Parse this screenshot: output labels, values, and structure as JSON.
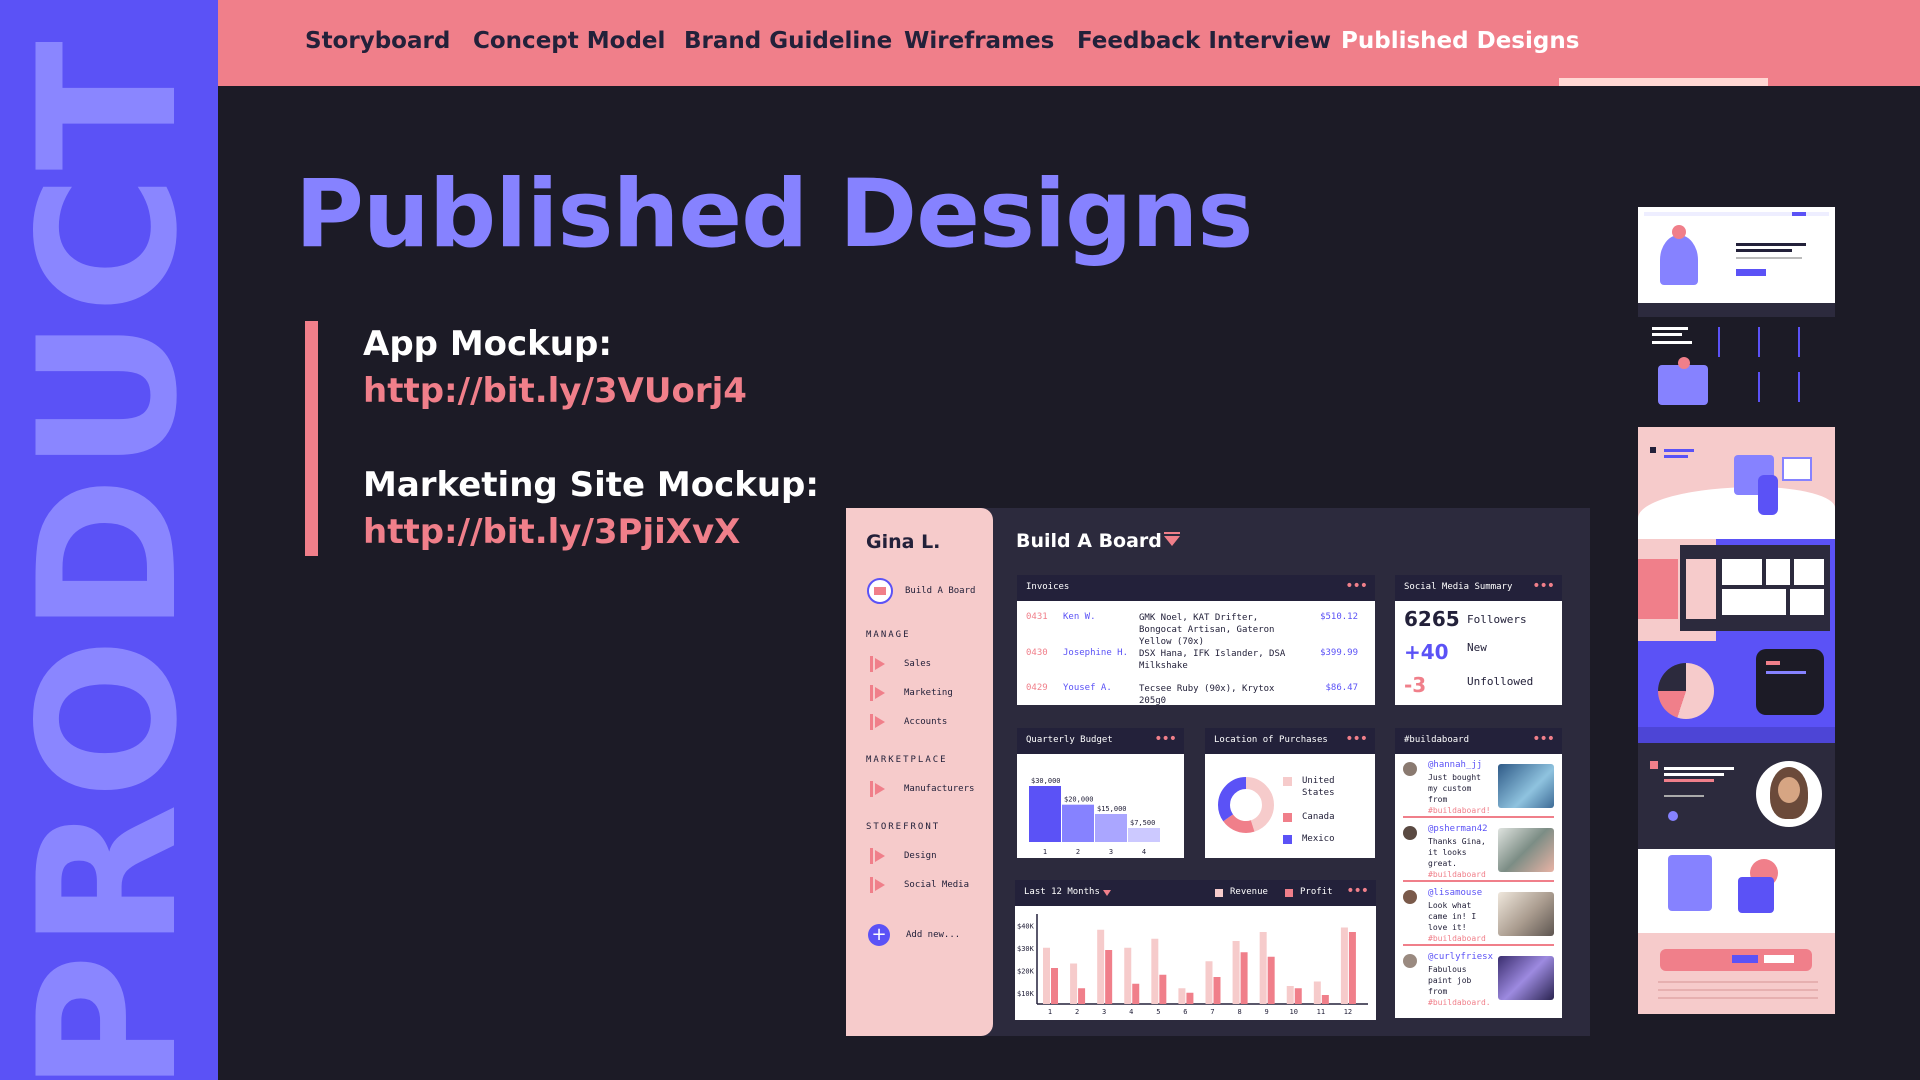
{
  "rail": {
    "word": "PRODUCT"
  },
  "nav": {
    "tabs": [
      "Storyboard",
      "Concept Model",
      "Brand Guideline",
      "Wireframes",
      "Feedback Interview",
      "Published Designs"
    ],
    "active": "Published Designs"
  },
  "page": {
    "title": "Published Designs",
    "links": [
      {
        "label": "App Mockup:",
        "url": "http://bit.ly/3VUorj4"
      },
      {
        "label": "Marketing Site Mockup:",
        "url": "http://bit.ly/3PjiXvX"
      }
    ]
  },
  "colors": {
    "purple": "#5b52f6",
    "lavender": "#8682ff",
    "pink": "#f07f8a",
    "blush": "#f6cbcb",
    "dark": "#1c1b26"
  },
  "app": {
    "user": "Gina L.",
    "board_name": "Build A Board",
    "sections": [
      {
        "heading": "MANAGE",
        "items": [
          "Sales",
          "Marketing",
          "Accounts"
        ]
      },
      {
        "heading": "MARKETPLACE",
        "items": [
          "Manufacturers"
        ]
      },
      {
        "heading": "STOREFRONT",
        "items": [
          "Design",
          "Social Media"
        ]
      }
    ],
    "add_new": "Add new...",
    "title": "Build A Board",
    "more": "•••",
    "invoices": {
      "title": "Invoices",
      "rows": [
        {
          "num": "0431",
          "name": "Ken W.",
          "desc": "GMK Noel, KAT Drifter, Bongocat Artisan, Gateron Yellow (70x)",
          "amount": "$510.12"
        },
        {
          "num": "0430",
          "name": "Josephine H.",
          "desc": "DSX Hana, IFK Islander, DSA Milkshake",
          "amount": "$399.99"
        },
        {
          "num": "0429",
          "name": "Yousef A.",
          "desc": "Tecsee Ruby (90x), Krytox 205g0",
          "amount": "$86.47"
        }
      ]
    },
    "social": {
      "title": "Social Media Summary",
      "rows": [
        {
          "value": "6265",
          "label": "Followers",
          "color": "#23213a"
        },
        {
          "value": "+40",
          "label": "New",
          "color": "#5b52f6"
        },
        {
          "value": "-3",
          "label": "Unfollowed",
          "color": "#f07f8a"
        }
      ]
    },
    "budget": {
      "title": "Quarterly Budget",
      "chart_data": {
        "type": "bar",
        "categories": [
          "1",
          "2",
          "3",
          "4"
        ],
        "values": [
          30000,
          20000,
          15000,
          7500
        ],
        "labels": [
          "$30,000",
          "$20,000",
          "$15,000",
          "$7,500"
        ],
        "colors": [
          "#5b52f6",
          "#8682ff",
          "#aaa6ff",
          "#ccc9ff"
        ]
      }
    },
    "location": {
      "title": "Location of Purchases",
      "chart_data": {
        "type": "pie",
        "labels": [
          "United States",
          "Canada",
          "Mexico"
        ],
        "values": [
          45,
          20,
          35
        ],
        "colors": [
          "#f6cbcb",
          "#f07f8a",
          "#5b52f6"
        ]
      }
    },
    "feed": {
      "title": "#buildaboard",
      "posts": [
        {
          "handle": "@hannah_jj",
          "text": "Just bought my custom from",
          "tag": "#buildaboard!",
          "img": "#5a8fb5"
        },
        {
          "handle": "@psherman42",
          "text": "Thanks Gina, it looks great.",
          "tag": "#buildaboard",
          "img": "#9aa7a2"
        },
        {
          "handle": "@lisamouse",
          "text": "Look what came in! I love it!",
          "tag": "#buildaboard",
          "img": "#b8aca3"
        },
        {
          "handle": "@curlyfriesx",
          "text": "Fabulous paint job from",
          "tag": "#buildaboard.",
          "img": "#7d64b8"
        }
      ]
    },
    "yearly": {
      "title": "Last 12 Months",
      "legend": [
        "Revenue",
        "Profit"
      ],
      "chart_data": {
        "type": "bar",
        "categories": [
          "1",
          "2",
          "3",
          "4",
          "5",
          "6",
          "7",
          "8",
          "9",
          "10",
          "11",
          "12"
        ],
        "yticks": [
          "$40K",
          "$30K",
          "$20K",
          "$10K"
        ],
        "ylim": [
          5000,
          45000
        ],
        "series": [
          {
            "name": "Revenue",
            "color": "#f6cbcb",
            "values": [
              30000,
              23000,
              38000,
              30000,
              34000,
              12000,
              24000,
              33000,
              37000,
              13000,
              15000,
              39000
            ]
          },
          {
            "name": "Profit",
            "color": "#f07f8a",
            "values": [
              21000,
              12000,
              29000,
              14000,
              18000,
              10000,
              17000,
              28000,
              26000,
              12000,
              9000,
              37000
            ]
          }
        ]
      }
    }
  }
}
